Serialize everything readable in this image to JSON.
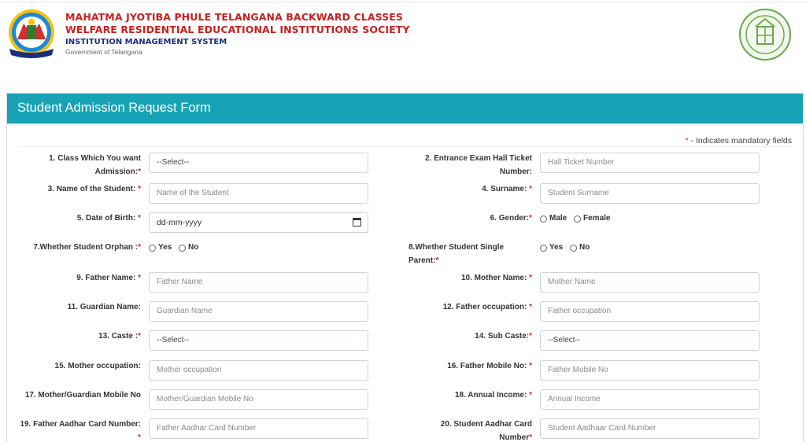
{
  "header": {
    "org_line1": "MAHATMA JYOTIBA PHULE TELANGANA BACKWARD CLASSES",
    "org_line2": "WELFARE RESIDENTIAL EDUCATIONAL INSTITUTIONS SOCIETY",
    "system_name": "INSTITUTION MANAGEMENT SYSTEM",
    "government": "Government of Telangana",
    "logo_left": "mjptbcwreis-logo",
    "logo_right": "telangana-emblem",
    "colors": {
      "org": "#c8201f",
      "system": "#1c2e7a"
    }
  },
  "form": {
    "title": "Student Admission Request Form",
    "mandatory_star": "*",
    "mandatory_note": " - Indicates mandatory fields",
    "header_color": "#17a2b5",
    "fields": {
      "f1": {
        "label": "1. Class Which You want Admission:",
        "req": "*",
        "value": "--Select--"
      },
      "f2": {
        "label": "2. Entrance Exam Hall Ticket Number:",
        "req": "",
        "placeholder": "Hall Ticket Number"
      },
      "f3": {
        "label": "3. Name of the Student:",
        "req": "*",
        "placeholder": "Name of the Student"
      },
      "f4": {
        "label": "4. Surname:",
        "req": "*",
        "placeholder": "Student Surname"
      },
      "f5": {
        "label": "5. Date of Birth:",
        "req": "*",
        "value": "dd-mm-yyyy"
      },
      "f6": {
        "label": "6. Gender:",
        "req": "*",
        "options": [
          "Male",
          "Female"
        ]
      },
      "f7": {
        "label": "7.Whether Student Orphan :",
        "req": "*",
        "options": [
          "Yes",
          "No"
        ]
      },
      "f8": {
        "label": "8.Whether Student Single Parent:",
        "req": "*",
        "options": [
          "Yes",
          "No"
        ]
      },
      "f9": {
        "label": "9. Father Name:",
        "req": "*",
        "placeholder": "Father Name"
      },
      "f10": {
        "label": "10. Mother Name:",
        "req": "*",
        "placeholder": "Mother Name"
      },
      "f11": {
        "label": "11. Guardian Name:",
        "req": "",
        "placeholder": "Guardian Name"
      },
      "f12": {
        "label": "12. Father occupation:",
        "req": "*",
        "placeholder": "Father occupation"
      },
      "f13": {
        "label": "13. Caste :",
        "req": "*",
        "value": "--Select--"
      },
      "f14": {
        "label": "14. Sub Caste:",
        "req": "*",
        "value": "--Select--"
      },
      "f15": {
        "label": "15. Mother occupation:",
        "req": "",
        "placeholder": "Mother occupation"
      },
      "f16": {
        "label": "16. Father Mobile No:",
        "req": "*",
        "placeholder": "Father Mobile No"
      },
      "f17": {
        "label": "17. Mother/Guardian Mobile No",
        "req": "",
        "placeholder": "Mother/Guardian Mobile No"
      },
      "f18": {
        "label": "18. Annual Income:",
        "req": "*",
        "placeholder": "Annual Income"
      },
      "f19": {
        "label": "19. Father Aadhar Card Number:",
        "req": "*",
        "placeholder": "Father Aadhar Card Number"
      },
      "f20": {
        "label": "20. Student Aadhar Card Number",
        "req": "*",
        "placeholder": "Student Aadhaar Card Number"
      }
    }
  }
}
